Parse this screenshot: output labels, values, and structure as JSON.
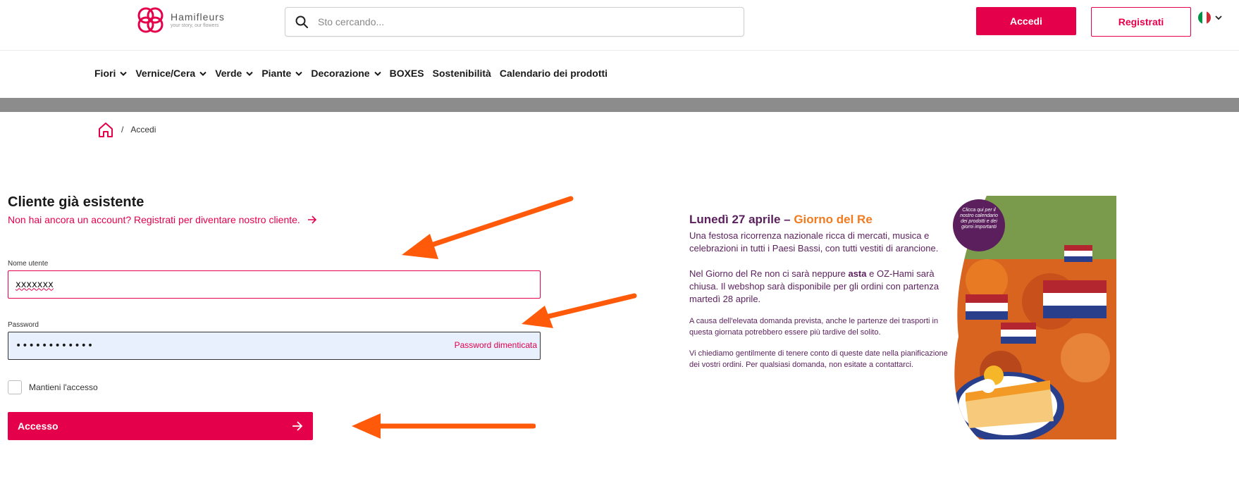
{
  "header": {
    "logo": {
      "name": "Hamifleurs",
      "tagline": "your story, our flowers"
    },
    "search": {
      "placeholder": "Sto cercando..."
    },
    "login_button": "Accedi",
    "register_button": "Registrati",
    "language": "it"
  },
  "nav": {
    "items": [
      {
        "label": "Fiori",
        "dropdown": true
      },
      {
        "label": "Vernice/Cera",
        "dropdown": true
      },
      {
        "label": "Verde",
        "dropdown": true
      },
      {
        "label": "Piante",
        "dropdown": true
      },
      {
        "label": "Decorazione",
        "dropdown": true
      },
      {
        "label": "BOXES",
        "dropdown": false
      },
      {
        "label": "Sostenibilità",
        "dropdown": false
      },
      {
        "label": "Calendario dei prodotti",
        "dropdown": false
      }
    ]
  },
  "breadcrumb": {
    "separator": "/",
    "current": "Accedi"
  },
  "login": {
    "title": "Cliente già esistente",
    "register_link": "Non hai ancora un account? Registrati per diventare nostro cliente.",
    "username_label": "Nome utente",
    "username_value": "xxxxxxx",
    "password_label": "Password",
    "password_value": "••••••••••••",
    "forgot_password": "Password dimenticata",
    "remember_label": "Mantieni l'accesso",
    "submit_label": "Accesso"
  },
  "promo": {
    "title_date": "Lunedì 27 aprile – ",
    "title_event": "Giorno del Re",
    "p1": "Una festosa ricorrenza nazionale ricca di mercati, musica e celebrazioni in tutti i Paesi Bassi, con tutti vestiti di arancione.",
    "p2_start": "Nel Giorno del Re non ci sarà neppure ",
    "p2_bold": "asta",
    "p2_end": " e OZ-Hami sarà chiusa. Il webshop sarà disponibile per gli ordini con partenza martedì 28 aprile.",
    "p3": "A causa dell'elevata domanda prevista, anche le partenze dei trasporti in questa giornata potrebbero essere più tardive del solito.",
    "p4": "Vi chiediamo gentilmente di tenere conto di queste date nella pianificazione dei vostri ordini. Per qualsiasi domanda, non esitate a contattarci.",
    "badge": "Clicca qui per il nostro calendario dei prodotti e dei giorni importanti"
  },
  "colors": {
    "brand": "#e4004b",
    "promo_purple": "#5a1f5c",
    "promo_orange": "#f27b1f",
    "annotation_arrow": "#ff5a0a"
  }
}
